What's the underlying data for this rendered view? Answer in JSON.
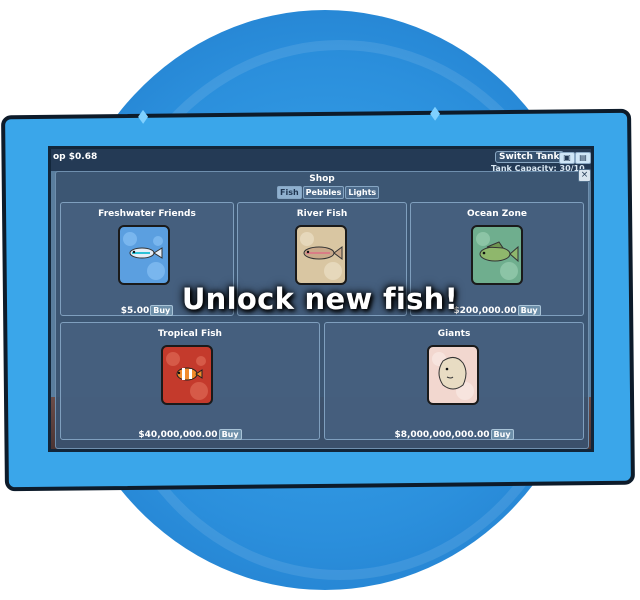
{
  "hud": {
    "money": "op $0.68",
    "switch_tank": "Switch Tank",
    "capacity": "Tank Capacity: 30/10"
  },
  "shop": {
    "title": "Shop",
    "close": "×",
    "tabs": [
      {
        "label": "Fish",
        "active": true
      },
      {
        "label": "Pebbles",
        "active": false
      },
      {
        "label": "Lights",
        "active": false
      }
    ],
    "items": [
      {
        "title": "Freshwater Friends",
        "price": "$5.00",
        "buy": "Buy",
        "icon": "neon-tetra-fish-icon",
        "color": "#5b9fe0"
      },
      {
        "title": "River Fish",
        "price": "",
        "buy": "",
        "icon": "trout-fish-icon",
        "color": "#d9c6a2"
      },
      {
        "title": "Ocean Zone",
        "price": "$200,000.00",
        "buy": "Buy",
        "icon": "bass-fish-icon",
        "color": "#6fae8e"
      },
      {
        "title": "Tropical Fish",
        "price": "$40,000,000.00",
        "buy": "Buy",
        "icon": "clownfish-icon",
        "color": "#c43a2c"
      },
      {
        "title": "Giants",
        "price": "$8,000,000,000.00",
        "buy": "Buy",
        "icon": "sunfish-icon",
        "color": "#f2d7cf"
      }
    ]
  },
  "headline": "Unlock new fish!"
}
